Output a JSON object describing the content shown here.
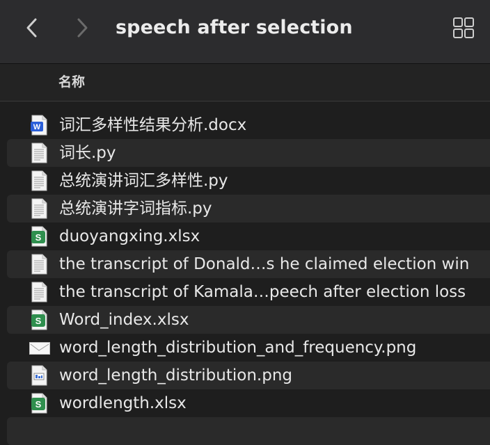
{
  "window": {
    "title": "speech after selection"
  },
  "toolbar": {
    "back_icon": "chevron-left-icon",
    "forward_icon": "chevron-right-icon",
    "view_icon": "grid-view-icon"
  },
  "list_header": {
    "name_column": "名称"
  },
  "files": [
    {
      "name": "词汇多样性结果分析.docx",
      "icon": "word-document-icon"
    },
    {
      "name": "词长.py",
      "icon": "text-file-icon"
    },
    {
      "name": "总统演讲词汇多样性.py",
      "icon": "text-file-icon"
    },
    {
      "name": "总统演讲字词指标.py",
      "icon": "text-file-icon"
    },
    {
      "name": "duoyangxing.xlsx",
      "icon": "spreadsheet-icon"
    },
    {
      "name": "the transcript of Donald…s he claimed election win",
      "icon": "text-file-icon"
    },
    {
      "name": "the transcript of Kamala…peech after election loss",
      "icon": "text-file-icon"
    },
    {
      "name": "Word_index.xlsx",
      "icon": "spreadsheet-icon"
    },
    {
      "name": "word_length_distribution_and_frequency.png",
      "icon": "image-thumbnail-icon"
    },
    {
      "name": "word_length_distribution.png",
      "icon": "image-file-icon"
    },
    {
      "name": "wordlength.xlsx",
      "icon": "spreadsheet-icon"
    }
  ],
  "colors": {
    "toolbar_bg": "#2c2c2e",
    "list_bg": "#1e1e1e",
    "alt_row_bg": "#2a2a2a",
    "word_blue": "#2b5fd9",
    "sheet_green": "#2f8f4e"
  }
}
